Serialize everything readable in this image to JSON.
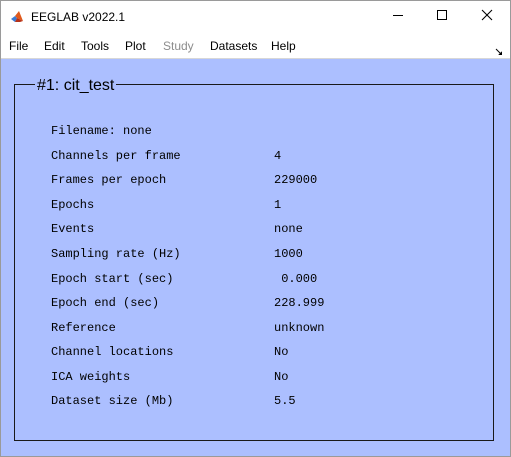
{
  "window": {
    "title": "EEGLAB v2022.1",
    "icon": "matlab-icon",
    "controls": [
      "minimize-icon",
      "maximize-icon",
      "close-icon"
    ]
  },
  "menu": {
    "items": [
      {
        "label": "File",
        "enabled": true
      },
      {
        "label": "Edit",
        "enabled": true
      },
      {
        "label": "Tools",
        "enabled": true
      },
      {
        "label": "Plot",
        "enabled": true
      },
      {
        "label": "Study",
        "enabled": false
      },
      {
        "label": "Datasets",
        "enabled": true
      },
      {
        "label": "Help",
        "enabled": true
      }
    ],
    "dock_icon": "dock-arrow-icon"
  },
  "dataset": {
    "title": "#1: cit_test",
    "filename_line": "Filename: none",
    "rows": [
      {
        "label": "Channels per frame",
        "value": "4"
      },
      {
        "label": "Frames per epoch",
        "value": "229000"
      },
      {
        "label": "Epochs",
        "value": "1"
      },
      {
        "label": "Events",
        "value": "none"
      },
      {
        "label": "Sampling rate (Hz)",
        "value": "1000"
      },
      {
        "label": "Epoch start (sec)",
        "value": " 0.000"
      },
      {
        "label": "Epoch end (sec)",
        "value": "228.999"
      },
      {
        "label": "Reference",
        "value": "unknown"
      },
      {
        "label": "Channel locations",
        "value": "No"
      },
      {
        "label": "ICA weights",
        "value": "No"
      },
      {
        "label": "Dataset size (Mb)",
        "value": "5.5"
      }
    ]
  },
  "colors": {
    "background": "#acbfff",
    "text": "#000000",
    "disabled_menu": "#8d8d8d"
  }
}
